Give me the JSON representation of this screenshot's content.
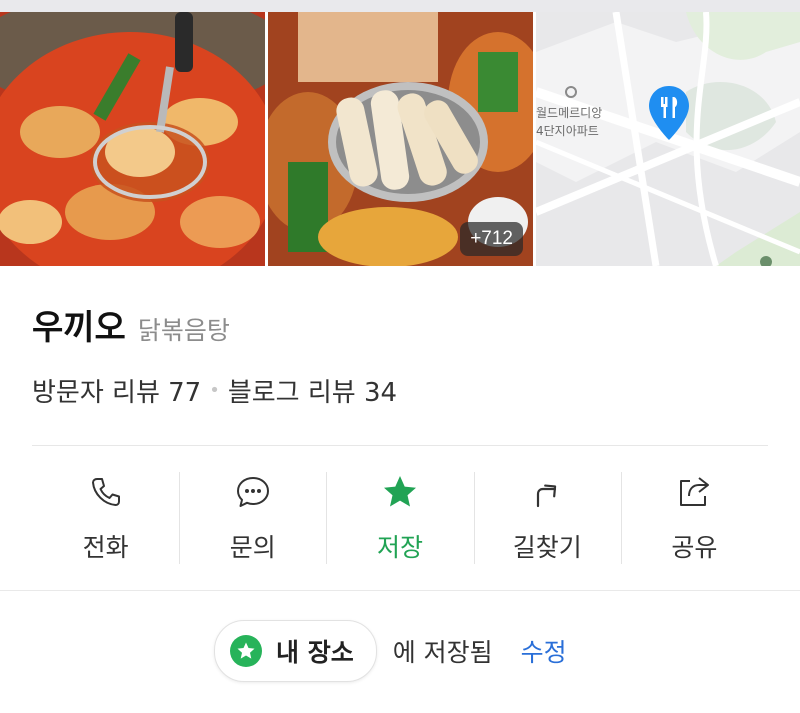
{
  "gallery": {
    "photo_count_label": "+712",
    "map_labels": [
      "월드메르디앙",
      "4단지아파트"
    ],
    "map_pin_icon": "restaurant-fork-knife-icon",
    "map_pin_color": "#1f8ef1"
  },
  "place": {
    "name": "우끼오",
    "category": "닭볶음탕",
    "visitor_reviews": "방문자 리뷰 77",
    "blog_reviews": "블로그 리뷰 34"
  },
  "actions": [
    {
      "label": "전화",
      "icon": "phone-icon"
    },
    {
      "label": "문의",
      "icon": "chat-bubble-icon"
    },
    {
      "label": "저장",
      "icon": "star-icon",
      "active": true,
      "color": "#21a354"
    },
    {
      "label": "길찾기",
      "icon": "directions-arrow-icon"
    },
    {
      "label": "공유",
      "icon": "share-icon"
    }
  ],
  "saved": {
    "list_name": "내 장소",
    "status_text": "에 저장됨",
    "edit_label": "수정",
    "accent_color": "#27b35a",
    "link_color": "#2a6fd8"
  }
}
